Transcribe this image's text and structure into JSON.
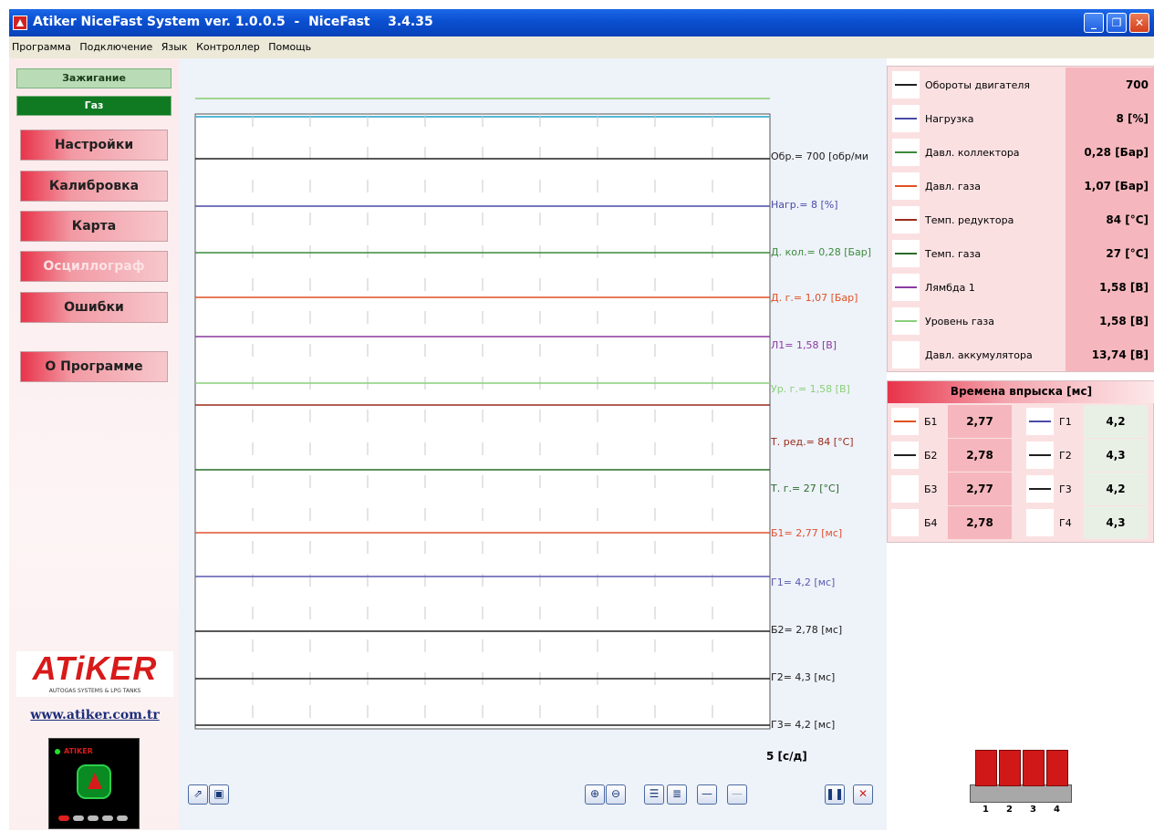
{
  "window": {
    "title": "Atiker NiceFast System ver. 1.0.0.5  -  NiceFast    3.4.35",
    "minimize": "_",
    "maximize": "❐",
    "close": "✕"
  },
  "menu": [
    "Программа",
    "Подключение",
    "Язык",
    "Контроллер",
    "Помощь"
  ],
  "modes": {
    "ignition": "Зажигание",
    "gas": "Газ"
  },
  "nav": [
    {
      "label": "Настройки",
      "active": false
    },
    {
      "label": "Калибровка",
      "active": false
    },
    {
      "label": "Карта",
      "active": false
    },
    {
      "label": "Осциллограф",
      "active": true
    },
    {
      "label": "Ошибки",
      "active": false
    },
    {
      "label": "О Программе",
      "active": false
    }
  ],
  "brand": {
    "logo": "ATiKER",
    "logo_sub": "AUTOGAS SYSTEMS & LPG TANKS",
    "website": "www.atiker.com.tr",
    "device_name": "ATIKER"
  },
  "oscilloscope": {
    "scale_label": "5 [с/д]",
    "channels": [
      {
        "label": "Обр.= 700 [обр/ми",
        "color": "#202020"
      },
      {
        "label": "Нагр.= 8 [%]",
        "color": "#4a4aa8"
      },
      {
        "label": "Д. кол.= 0,28 [Бар]",
        "color": "#3c8a3c"
      },
      {
        "label": "Д. г.= 1,07 [Бар]",
        "color": "#e05020"
      },
      {
        "label": "Л1= 1,58 [В]",
        "color": "#8a3aa0"
      },
      {
        "label": "Ур. г.= 1,58 [В]",
        "color": "#8ad07a"
      },
      {
        "label": "Т. ред.= 84 [°C]",
        "color": "#9a2a1a"
      },
      {
        "label": "Т. г.= 27 [°C]",
        "color": "#2a6a2a"
      },
      {
        "label": "Б1= 2,77 [мс]",
        "color": "#e05030"
      },
      {
        "label": "Г1= 4,2 [мс]",
        "color": "#5a5ab0"
      },
      {
        "label": "Б2= 2,78 [мс]",
        "color": "#202020"
      },
      {
        "label": "Г2= 4,3 [мс]",
        "color": "#202020"
      },
      {
        "label": "Г3= 4,2 [мс]",
        "color": "#202020"
      }
    ]
  },
  "params": [
    {
      "name": "Обороты двигателя",
      "value": "700",
      "color": "#202020"
    },
    {
      "name": "Нагрузка",
      "value": "8 [%]",
      "color": "#4a4aa8"
    },
    {
      "name": "Давл. коллектора",
      "value": "0,28 [Бар]",
      "color": "#3c8a3c"
    },
    {
      "name": "Давл. газа",
      "value": "1,07 [Бар]",
      "color": "#e05020"
    },
    {
      "name": "Темп. редуктора",
      "value": "84 [°C]",
      "color": "#9a2a1a"
    },
    {
      "name": "Темп. газа",
      "value": "27 [°C]",
      "color": "#2a6a2a"
    },
    {
      "name": "Лямбда 1",
      "value": "1,58 [В]",
      "color": "#8a3aa0"
    },
    {
      "name": "Уровень газа",
      "value": "1,58 [В]",
      "color": "#8ad07a"
    },
    {
      "name": "Давл. аккумулятора",
      "value": "13,74 [В]",
      "color": ""
    }
  ],
  "injection": {
    "title": "Времена впрыска [мс]",
    "rows": [
      {
        "b_name": "Б1",
        "b_value": "2,77",
        "b_color": "#e05020",
        "g_name": "Г1",
        "g_value": "4,2",
        "g_color": "#4a4aa8"
      },
      {
        "b_name": "Б2",
        "b_value": "2,78",
        "b_color": "#202020",
        "g_name": "Г2",
        "g_value": "4,3",
        "g_color": "#202020"
      },
      {
        "b_name": "Б3",
        "b_value": "2,77",
        "b_color": "",
        "g_name": "Г3",
        "g_value": "4,2",
        "g_color": "#202020"
      },
      {
        "b_name": "Б4",
        "b_value": "2,78",
        "b_color": "",
        "g_name": "Г4",
        "g_value": "4,3",
        "g_color": ""
      }
    ]
  },
  "injectors": [
    "1",
    "2",
    "3",
    "4"
  ],
  "toolbar_icons": [
    "open-icon",
    "save-icon",
    "zoom-in-icon",
    "zoom-out-icon",
    "lines-few-icon",
    "lines-many-icon",
    "line-single-icon",
    "line-disabled-icon",
    "pause-icon",
    "stop-icon"
  ]
}
